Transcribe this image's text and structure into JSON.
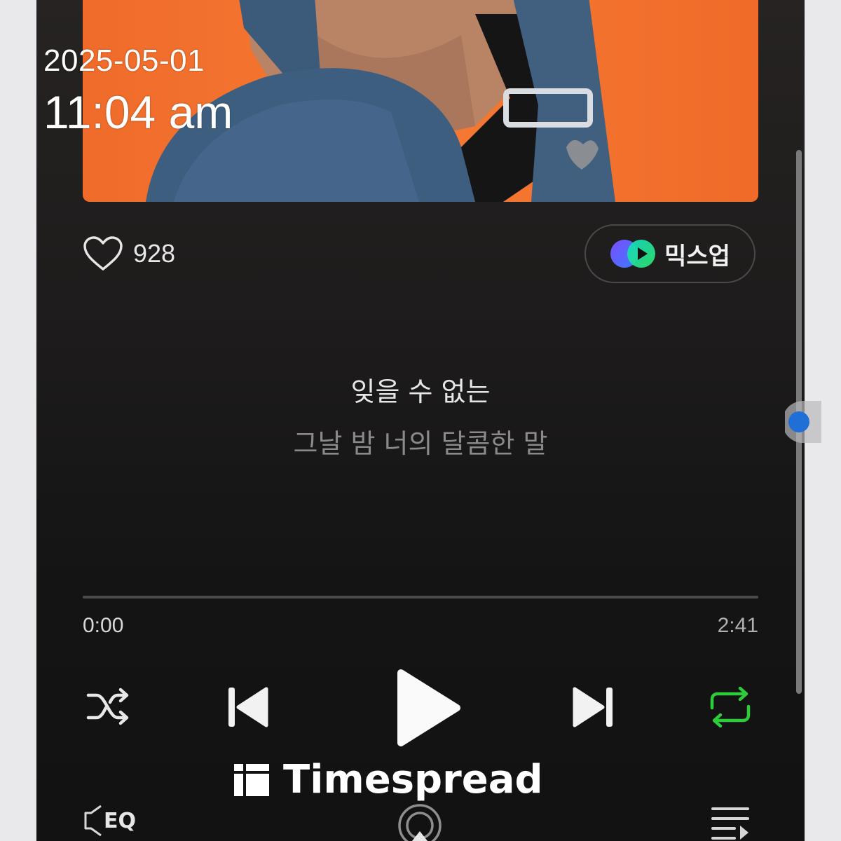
{
  "overlay": {
    "date": "2025-05-01",
    "time": "11:04 am"
  },
  "like": {
    "count": "928",
    "icon": "heart-outline-icon"
  },
  "mixup": {
    "label": "믹스업",
    "icon": "mixup-logo-icon"
  },
  "lyrics": {
    "current": "잊을 수 없는",
    "next": "그날 밤 너의 달콤한 말"
  },
  "playback": {
    "elapsed": "0:00",
    "total": "2:41",
    "progress": 0
  },
  "controls": {
    "shuffle": "shuffle-icon",
    "previous": "skip-previous-icon",
    "play": "play-icon",
    "next": "skip-next-icon",
    "repeat": "repeat-icon",
    "repeat_active": true
  },
  "bottom": {
    "eq_label": "EQ",
    "cast": "cast-icon",
    "playlist": "playlist-icon"
  },
  "watermark": {
    "text": "Timespread"
  },
  "colors": {
    "accent_green": "#2ecc3a",
    "background": "#1b1a1a",
    "album_orange": "#f27130"
  }
}
